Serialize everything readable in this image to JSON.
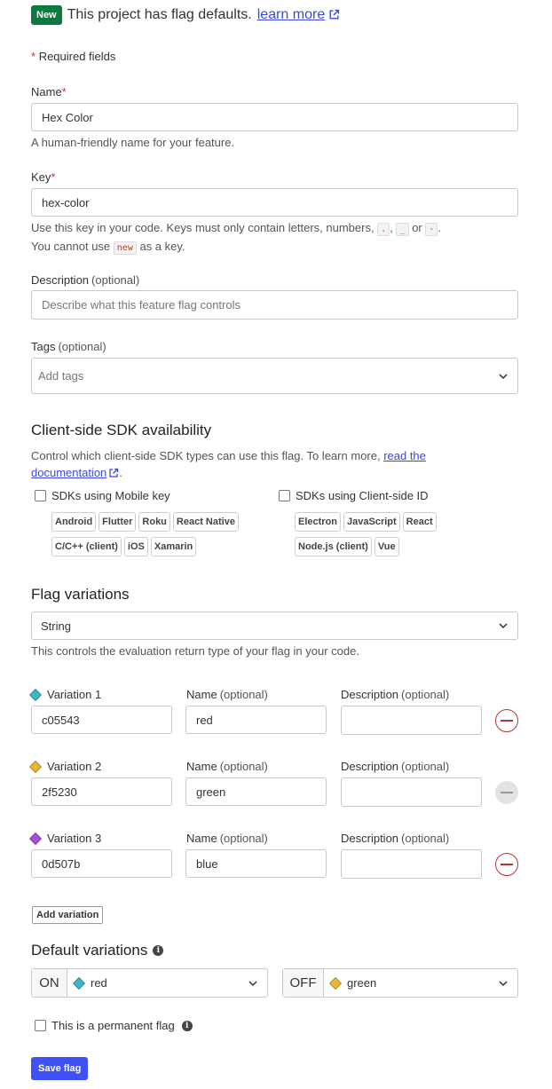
{
  "banner": {
    "badge": "New",
    "text": "This project has flag defaults.",
    "link": "learn more"
  },
  "required_note": {
    "star": "*",
    "text": "Required fields"
  },
  "name": {
    "label": "Name",
    "star": "*",
    "value": "Hex Color",
    "hint": "A human-friendly name for your feature."
  },
  "key": {
    "label": "Key",
    "star": "*",
    "value": "hex-color",
    "hint_part1": "Use this key in your code. Keys must only contain letters, numbers,",
    "char_dot": ".",
    "sep1": ",",
    "char_underscore": "_",
    "sep2": "or",
    "char_dash": "-",
    "end": ".",
    "hint_part2": "You cannot use",
    "reserved": "new",
    "hint_part3": "as a key."
  },
  "description": {
    "label": "Description",
    "optional": "(optional)",
    "placeholder": "Describe what this feature flag controls"
  },
  "tags": {
    "label": "Tags",
    "optional": "(optional)",
    "placeholder": "Add tags"
  },
  "sdk": {
    "heading": "Client-side SDK availability",
    "desc": "Control which client-side SDK types can use this flag. To learn more,",
    "link1": "read the",
    "link2": "documentation",
    "end": ".",
    "mobile": {
      "label": "SDKs using Mobile key",
      "tags": [
        "Android",
        "Flutter",
        "Roku",
        "React Native",
        "C/C++ (client)",
        "iOS",
        "Xamarin"
      ]
    },
    "client": {
      "label": "SDKs using Client-side ID",
      "tags": [
        "Electron",
        "JavaScript",
        "React",
        "Node.js (client)",
        "Vue"
      ]
    }
  },
  "variations": {
    "heading": "Flag variations",
    "type": "String",
    "hint": "This controls the evaluation return type of your flag in your code.",
    "name_label": "Name",
    "desc_label": "Description",
    "optional": "(optional)",
    "items": [
      {
        "label": "Variation 1",
        "value": "c05543",
        "name": "red",
        "description": "",
        "color": "#3fb6c8",
        "removable": true
      },
      {
        "label": "Variation 2",
        "value": "2f5230",
        "name": "green",
        "description": "",
        "color": "#e8b930",
        "removable": false
      },
      {
        "label": "Variation 3",
        "value": "0d507b",
        "name": "blue",
        "description": "",
        "color": "#a64fd8",
        "removable": true
      }
    ],
    "add_button": "Add variation"
  },
  "defaults": {
    "heading": "Default variations",
    "on": {
      "prefix": "ON",
      "value": "red",
      "color": "#3fb6c8"
    },
    "off": {
      "prefix": "OFF",
      "value": "green",
      "color": "#e8b930"
    }
  },
  "permanent": {
    "label": "This is a permanent flag"
  },
  "save_button": "Save flag",
  "colors": {
    "accent": "#3f51f5",
    "danger": "#b5333a",
    "badge_green": "#0b7a3e",
    "link": "#3b49df"
  }
}
